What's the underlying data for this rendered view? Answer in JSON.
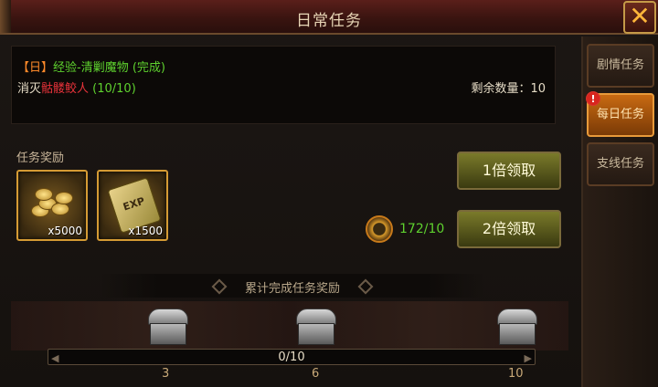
{
  "window": {
    "title": "日常任务"
  },
  "tabs": [
    {
      "label": "剧情任务",
      "active": false,
      "alert": false
    },
    {
      "label": "每日任务",
      "active": true,
      "alert": true
    },
    {
      "label": "支线任务",
      "active": false,
      "alert": false
    }
  ],
  "alert_glyph": "!",
  "close_glyph": "✕",
  "task": {
    "tag": "【日】",
    "name": "经验-清剿魔物",
    "status": "(完成)",
    "objective_prefix": "消灭",
    "target": "骷髅鲛人",
    "progress": "(10/10)",
    "remaining_label": "剩余数量：",
    "remaining_value": "10"
  },
  "rewards": {
    "label": "任务奖励",
    "items": [
      {
        "icon": "gold-coins-icon",
        "qty": "x5000"
      },
      {
        "icon": "exp-scroll-icon",
        "text": "EXP",
        "qty": "x1500"
      }
    ]
  },
  "buttons": {
    "claim_1x": "1倍领取",
    "claim_2x": "2倍领取"
  },
  "token": {
    "icon": "daily-token-icon",
    "value": "172/10"
  },
  "cumulative": {
    "label": "累计完成任务奖励",
    "progress_text": "0/10",
    "progress_fraction": 0,
    "milestones": [
      "3",
      "6",
      "10"
    ]
  },
  "colors": {
    "accent_orange": "#ff8a2a",
    "complete_green": "#5ed12e",
    "target_red": "#e8323a"
  }
}
